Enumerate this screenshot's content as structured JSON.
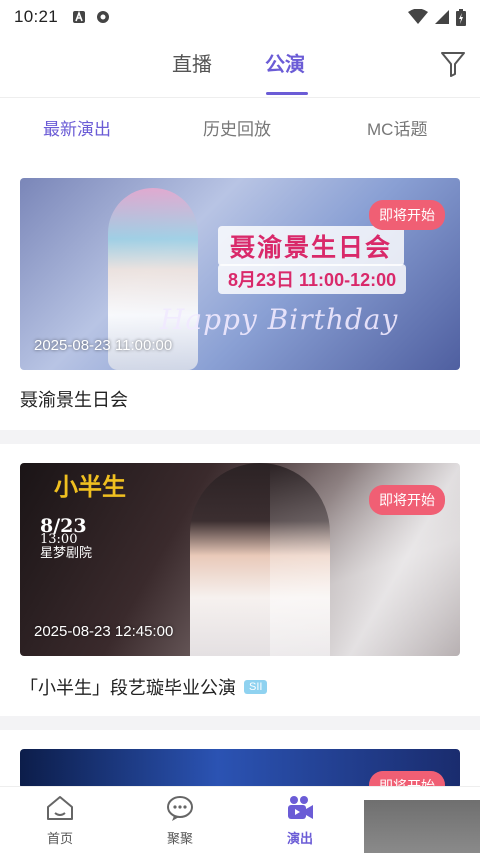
{
  "status_bar": {
    "time": "10:21"
  },
  "top_tabs": {
    "live": "直播",
    "performance": "公演"
  },
  "sub_tabs": {
    "latest": "最新演出",
    "history": "历史回放",
    "mc": "MC话题"
  },
  "cards": [
    {
      "badge": "即将开始",
      "time": "2025-08-23 11:00:00",
      "title": "聂渝景生日会",
      "poster_title": "聂渝景生日会",
      "poster_date": "8月23日 11:00-12:00",
      "poster_script": "Happy Birthday"
    },
    {
      "badge": "即将开始",
      "time": "2025-08-23 12:45:00",
      "title": "「小半生」段艺璇毕业公演",
      "team_tag": "SII",
      "poster_logo": "小半生",
      "poster_date_big": "8/23",
      "poster_time": "13:00",
      "poster_venue": "星梦剧院"
    },
    {
      "badge": "即将开始"
    }
  ],
  "bottom_nav": {
    "home": "首页",
    "juju": "聚聚",
    "performance": "演出"
  },
  "colors": {
    "accent": "#6b5cd6",
    "badge": "#f05f74",
    "team_tag": "#8fd2f0"
  }
}
